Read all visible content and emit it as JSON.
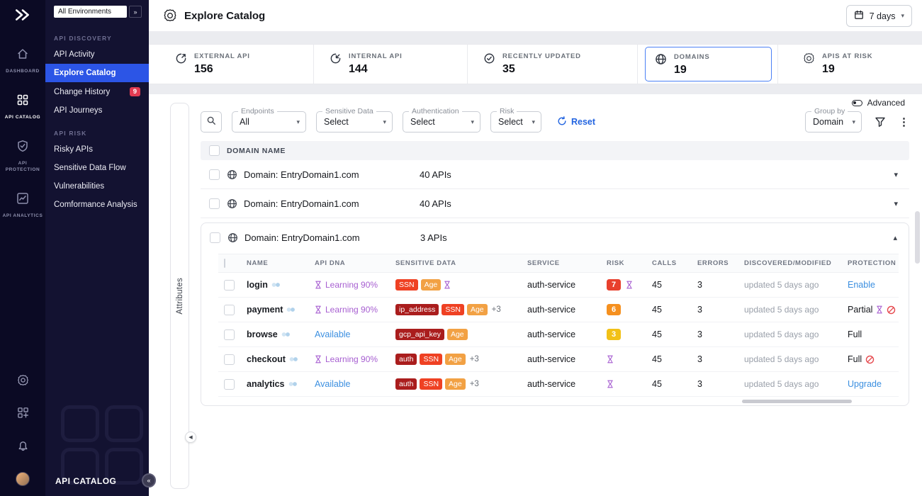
{
  "icons": {
    "chevron_down": "▾",
    "chevron_up": "▴",
    "kebab": "⋮",
    "collapse_left": "◀",
    "expand_right": "»",
    "collapse_circle": "«"
  },
  "sidebar": {
    "environments": "All Environments",
    "rail": [
      {
        "label": "DASHBOARD"
      },
      {
        "label": "API CATALOG"
      },
      {
        "label": "API PROTECTION"
      },
      {
        "label": "API ANALYTICS"
      }
    ],
    "sections": [
      {
        "title": "API DISCOVERY",
        "items": [
          {
            "label": "API Activity"
          },
          {
            "label": "Explore Catalog"
          },
          {
            "label": "Change History",
            "badge": "9"
          },
          {
            "label": "API Journeys"
          }
        ]
      },
      {
        "title": "API RISK",
        "items": [
          {
            "label": "Risky APIs"
          },
          {
            "label": "Sensitive Data Flow"
          },
          {
            "label": "Vulnerabilities"
          },
          {
            "label": "Comformance Analysis"
          }
        ]
      }
    ],
    "footer": "API CATALOG"
  },
  "header": {
    "title": "Explore Catalog",
    "date_range": "7 days"
  },
  "stats": [
    {
      "label": "EXTERNAL API",
      "value": "156"
    },
    {
      "label": "INTERNAL API",
      "value": "144"
    },
    {
      "label": "RECENTLY UPDATED",
      "value": "35"
    },
    {
      "label": "DOMAINS",
      "value": "19",
      "selected": true
    },
    {
      "label": "APIS AT RISK",
      "value": "19"
    }
  ],
  "filters": {
    "advanced": "Advanced",
    "endpoints": {
      "label": "Endpoints",
      "value": "All"
    },
    "sensitive": {
      "label": "Sensitive Data",
      "value": "Select"
    },
    "authentication": {
      "label": "Authentication",
      "value": "Select"
    },
    "risk": {
      "label": "Risk",
      "value": "Select"
    },
    "reset": "Reset",
    "group_by": {
      "label": "Group by",
      "value": "Domain"
    }
  },
  "attributes_panel": {
    "label": "Attributes"
  },
  "catalog": {
    "domain_column": "DOMAIN NAME",
    "groups": [
      {
        "name": "Domain: EntryDomain1.com",
        "count": "40 APIs"
      },
      {
        "name": "Domain: EntryDomain1.com",
        "count": "40 APIs"
      },
      {
        "name": "Domain: EntryDomain1.com",
        "count": "3 APIs",
        "expanded": true
      }
    ],
    "columns": [
      "NAME",
      "API DNA",
      "SENSITIVE DATA",
      "SERVICE",
      "RISK",
      "CALLS",
      "ERRORS",
      "DISCOVERED/MODIFIED",
      "PROTECTION"
    ],
    "rows": [
      {
        "name": "login",
        "dna": "Learning 90%",
        "dna_state": "learning",
        "badges": [
          {
            "label": "SSN",
            "color": "#ef4123"
          },
          {
            "label": "Age",
            "color": "#f2a144"
          }
        ],
        "service": "auth-service",
        "risk": "7",
        "risk_color": "#e8402d",
        "calls": "45",
        "errors": "3",
        "modified": "updated 5 days ago",
        "protection": "Enable"
      },
      {
        "name": "payment",
        "dna": "Learning 90%",
        "dna_state": "learning",
        "badges": [
          {
            "label": "ip_address",
            "color": "#aa1d1d"
          },
          {
            "label": "SSN",
            "color": "#ef4123"
          },
          {
            "label": "Age",
            "color": "#f2a144"
          }
        ],
        "extra": "+3",
        "service": "auth-service",
        "risk": "6",
        "risk_color": "#f5901f",
        "calls": "45",
        "errors": "3",
        "modified": "updated 5 days ago",
        "protection": "Partial"
      },
      {
        "name": "browse",
        "dna": "Available",
        "dna_state": "available",
        "badges": [
          {
            "label": "gcp_api_key",
            "color": "#aa1d1d"
          },
          {
            "label": "Age",
            "color": "#f2a144"
          }
        ],
        "service": "auth-service",
        "risk": "3",
        "risk_color": "#f2c117",
        "calls": "45",
        "errors": "3",
        "modified": "updated 5 days ago",
        "protection": "Full"
      },
      {
        "name": "checkout",
        "dna": "Learning 90%",
        "dna_state": "learning",
        "badges": [
          {
            "label": "auth",
            "color": "#aa1d1d"
          },
          {
            "label": "SSN",
            "color": "#ef4123"
          },
          {
            "label": "Age",
            "color": "#f2a144"
          }
        ],
        "extra": "+3",
        "service": "auth-service",
        "calls": "45",
        "errors": "3",
        "modified": "updated 5 days ago",
        "protection": "Full"
      },
      {
        "name": "analytics",
        "dna": "Available",
        "dna_state": "available",
        "badges": [
          {
            "label": "auth",
            "color": "#aa1d1d"
          },
          {
            "label": "SSN",
            "color": "#ef4123"
          },
          {
            "label": "Age",
            "color": "#f2a144"
          }
        ],
        "extra": "+3",
        "service": "auth-service",
        "calls": "45",
        "errors": "3",
        "modified": "updated 5 days ago",
        "protection": "Upgrade"
      }
    ]
  }
}
